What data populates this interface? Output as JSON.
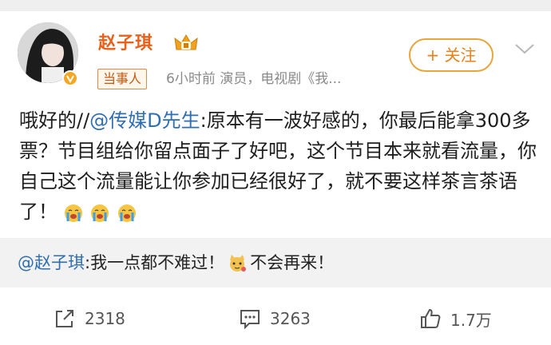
{
  "post": {
    "author": "赵子琪",
    "badge": "当事人",
    "meta": "6小时前   演员，电视剧《我...",
    "follow_label": "+ 关注",
    "body_prefix": "哦好的//",
    "mention": "@传媒D先生",
    "body_text": ":原本有一波好感的，你最后能拿300多票？节目组给你留点面子了好吧，这个节目本来就看流量，你自己这个流量能让你参加已经很好了，就不要这样茶言茶语了！",
    "reply_mention": "@赵子琪",
    "reply_text_a": ":我一点都不难过！",
    "reply_text_b": "不会再来！",
    "shares": "2318",
    "comments": "3263",
    "likes": "1.7万"
  },
  "icons": [
    "avatar-image",
    "verified-v-icon",
    "crown-icon",
    "chevron-down-icon",
    "crying-emoji-icon",
    "cat-emoji-icon",
    "share-icon",
    "comment-icon",
    "like-icon"
  ],
  "colors": {
    "username": "#e8601a",
    "mention": "#2f6eb1",
    "follow_border": "#e6a63c",
    "badge_border": "#e08a4a",
    "reply_bg": "#f2f2f2"
  }
}
